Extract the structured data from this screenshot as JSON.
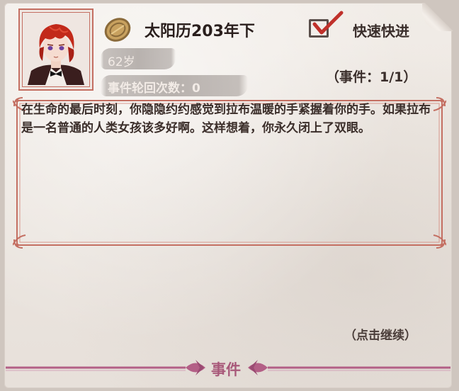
{
  "header": {
    "calendar_date": "太阳历203年下",
    "age": "62岁",
    "event_loop_label": "事件轮回次数：0"
  },
  "fast_forward": {
    "label": "快速快进",
    "checked": true
  },
  "event_counter": "（事件：1/1）",
  "story": {
    "text": "在生命的最后时刻，你隐隐约约感觉到拉布温暖的手紧握着你的手。如果拉布是一名普通的人类女孩该多好啊。这样想着，你永久闭上了双眼。"
  },
  "continue_hint": "（点击继续）",
  "footer": {
    "label": "事件"
  },
  "colors": {
    "frame_accent": "#c46f62",
    "footer_accent": "#b35f86",
    "check_red": "#c0312b"
  }
}
